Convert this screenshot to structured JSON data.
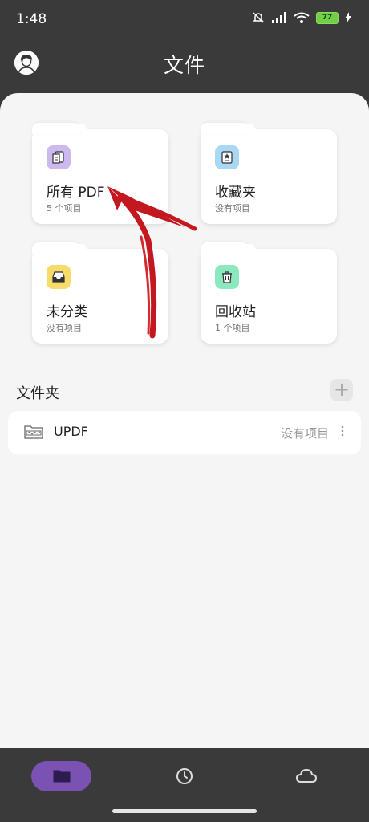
{
  "status": {
    "time": "1:48",
    "battery": "77"
  },
  "header": {
    "title": "文件"
  },
  "cards": [
    {
      "title": "所有 PDF",
      "subtitle": "5 个项目",
      "icon": "pdf-files-icon",
      "color": "#cdb8ef"
    },
    {
      "title": "收藏夹",
      "subtitle": "没有项目",
      "icon": "bookmark-star-icon",
      "color": "#a9d8f5"
    },
    {
      "title": "未分类",
      "subtitle": "没有项目",
      "icon": "inbox-tray-icon",
      "color": "#f7dc6b"
    },
    {
      "title": "回收站",
      "subtitle": "1 个项目",
      "icon": "trash-can-icon",
      "color": "#8be8bf"
    }
  ],
  "folders": {
    "section_title": "文件夹",
    "add_label": "+",
    "items": [
      {
        "name": "UPDF",
        "count": "没有项目"
      }
    ]
  },
  "nav": {
    "active_color": "#7a52b3",
    "items": [
      "folder-icon",
      "clock-icon",
      "cloud-icon"
    ]
  }
}
